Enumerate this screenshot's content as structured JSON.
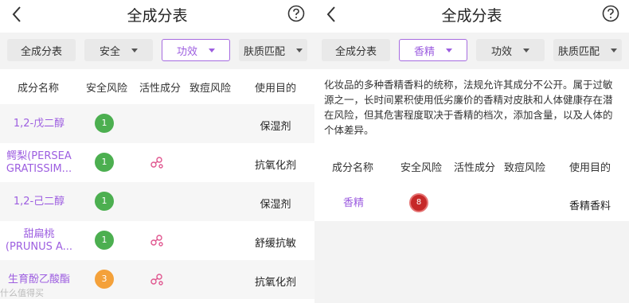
{
  "left": {
    "title": "全成分表",
    "filters": [
      {
        "label": "全成分表",
        "has_caret": false,
        "active": false
      },
      {
        "label": "安全",
        "has_caret": true,
        "active": false
      },
      {
        "label": "功效",
        "has_caret": true,
        "active": true
      },
      {
        "label": "肤质匹配",
        "has_caret": true,
        "active": false
      }
    ],
    "columns": [
      "成分名称",
      "安全风险",
      "活性成分",
      "致痘风险",
      "使用目的"
    ],
    "rows": [
      {
        "name": "1,2-戊二醇",
        "risk": "1",
        "risk_color": "green",
        "active": false,
        "purpose": "保湿剂"
      },
      {
        "name": "鳄梨(PERSEA GRATISSIM...",
        "risk": "1",
        "risk_color": "green",
        "active": true,
        "purpose": "抗氧化剂"
      },
      {
        "name": "1,2-己二醇",
        "risk": "1",
        "risk_color": "green",
        "active": false,
        "purpose": "保湿剂"
      },
      {
        "name": "甜扁桃(PRUNUS A...",
        "risk": "1",
        "risk_color": "green",
        "active": true,
        "purpose": "舒缓抗敏"
      },
      {
        "name": "生育酚乙酸酯",
        "risk": "3",
        "risk_color": "orange",
        "active": true,
        "purpose": "抗氧化剂"
      }
    ],
    "watermark": "什么值得买"
  },
  "right": {
    "title": "全成分表",
    "filters": [
      {
        "label": "全成分表",
        "has_caret": false,
        "active": false
      },
      {
        "label": "香精",
        "has_caret": true,
        "active": true
      },
      {
        "label": "功效",
        "has_caret": true,
        "active": false
      },
      {
        "label": "肤质匹配",
        "has_caret": true,
        "active": false
      }
    ],
    "description": "化妆品的多种香精香料的统称，法规允许其成分不公开。属于过敏源之一，长时间累积使用低劣廉价的香精对皮肤和人体健康存在潜在风险，但其危害程度取决于香精的档次，添加含量，以及人体的个体差异。",
    "columns": [
      "成分名称",
      "安全风险",
      "活性成分",
      "致痘风险",
      "使用目的"
    ],
    "rows": [
      {
        "name": "香精",
        "risk": "8",
        "risk_color": "red",
        "active": false,
        "purpose": "香精香料"
      }
    ]
  },
  "colors": {
    "accent": "#9d5ee0",
    "green": "#4caf50",
    "orange": "#f4a13a",
    "red": "#c62828",
    "active_icon": "#e0568f"
  },
  "icons": {
    "back": "chevron-left-icon",
    "help": "question-circle-icon",
    "active": "molecule-icon"
  }
}
